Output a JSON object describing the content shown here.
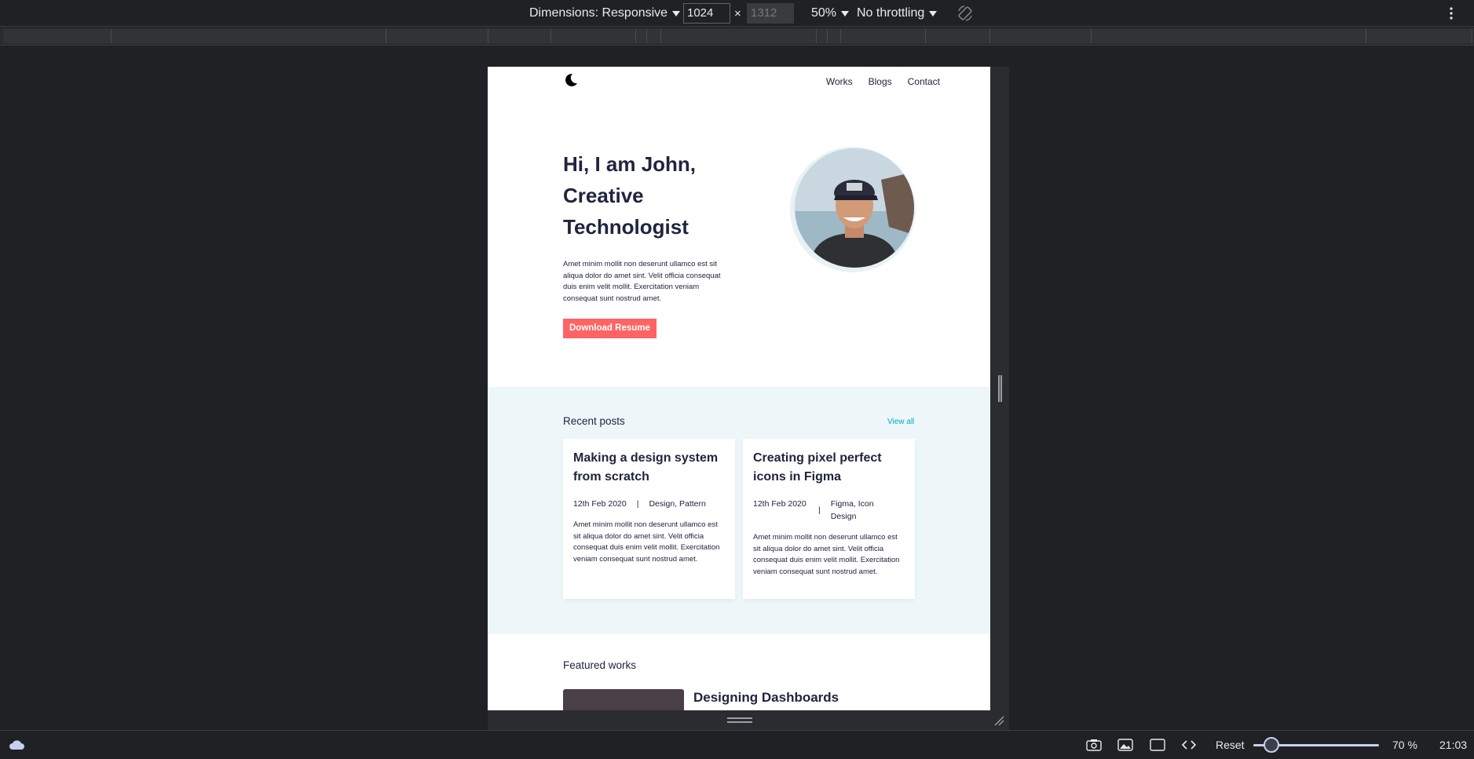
{
  "devtools": {
    "dimensions_label": "Dimensions: Responsive",
    "width_value": "1024",
    "times": "×",
    "height_placeholder": "1312",
    "zoom": "50%",
    "throttling": "No throttling"
  },
  "site": {
    "nav": {
      "links": [
        "Works",
        "Blogs",
        "Contact"
      ]
    },
    "hero": {
      "title_line1": "Hi, I am John,",
      "title_line2": "Creative",
      "title_line3": "Technologist",
      "text": "Amet minim mollit non deserunt ullamco est sit aliqua dolor do amet sint. Velit officia consequat duis enim velit mollit. Exercitation veniam consequat sunt nostrud amet.",
      "button": "Download Resume"
    },
    "recent_posts": {
      "heading": "Recent posts",
      "view_all": "View all",
      "posts": [
        {
          "title": "Making a design system from scratch",
          "date": "12th Feb 2020",
          "separator": "|",
          "tags": "Design, Pattern",
          "excerpt": "Amet minim mollit non deserunt ullamco est sit aliqua dolor do amet sint. Velit officia consequat duis enim velit mollit. Exercitation veniam consequat sunt nostrud amet."
        },
        {
          "title": "Creating pixel perfect icons in Figma",
          "date": "12th Feb 2020",
          "separator": "|",
          "tags": "Figma, Icon Design",
          "excerpt": "Amet minim mollit non deserunt ullamco est sit aliqua dolor do amet sint. Velit officia consequat duis enim velit mollit. Exercitation veniam consequat sunt nostrud amet."
        }
      ]
    },
    "featured": {
      "heading": "Featured works",
      "first_work_title": "Designing Dashboards"
    }
  },
  "statusbar": {
    "reset": "Reset",
    "zoom": "70 %",
    "time": "21:03"
  },
  "colors": {
    "accent": "#ff6464",
    "link": "#00a8cc",
    "heading": "#21243d",
    "posts_bg": "#edf7fa"
  }
}
